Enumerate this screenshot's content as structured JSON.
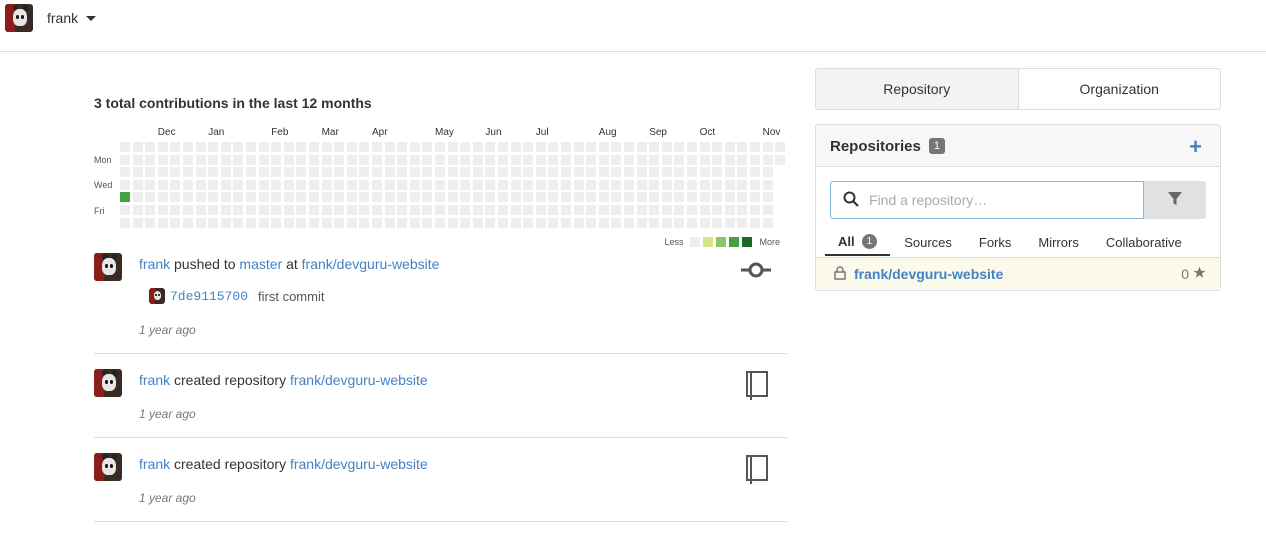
{
  "header": {
    "username": "frank"
  },
  "heatmap": {
    "title": "3 total contributions in the last 12 months",
    "months": [
      "Dec",
      "Jan",
      "Feb",
      "Mar",
      "Apr",
      "May",
      "Jun",
      "Jul",
      "Aug",
      "Sep",
      "Oct",
      "Nov"
    ],
    "days": [
      "Mon",
      "Wed",
      "Fri"
    ],
    "legend_less": "Less",
    "legend_more": "More",
    "colors": [
      "#eeeeee",
      "#d6e685",
      "#8cc665",
      "#44a340",
      "#1e6823"
    ],
    "active_cell": {
      "week": 0,
      "day": 4,
      "level": 3
    }
  },
  "feed": [
    {
      "user": "frank",
      "action": "pushed to",
      "branch": "master",
      "connector": "at",
      "repo": "frank/devguru-website",
      "commit_sha": "7de9115700",
      "commit_message": "first commit",
      "time": "1 year ago",
      "icon": "git-commit-icon"
    },
    {
      "user": "frank",
      "action": "created repository",
      "repo": "frank/devguru-website",
      "time": "1 year ago",
      "icon": "repo-book-icon"
    },
    {
      "user": "frank",
      "action": "created repository",
      "repo": "frank/devguru-website",
      "time": "1 year ago",
      "icon": "repo-book-icon"
    }
  ],
  "dashboard": {
    "tabs": [
      "Repository",
      "Organization"
    ],
    "repos_title": "Repositories",
    "repos_count": "1",
    "search_placeholder": "Find a repository…",
    "filters": [
      "All",
      "Sources",
      "Forks",
      "Mirrors",
      "Collaborative"
    ],
    "all_count": "1",
    "repo_list": [
      {
        "name": "frank/devguru-website",
        "stars": "0",
        "private": true
      }
    ]
  }
}
